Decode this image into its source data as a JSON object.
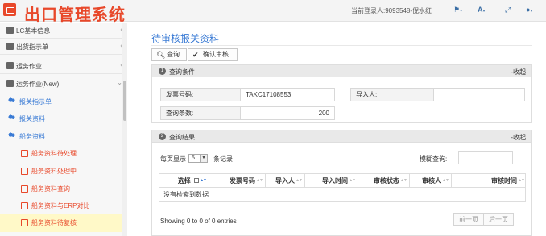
{
  "header": {
    "app_title": "出口管理系统",
    "user_info": "当前登录人:9093548-倪水红",
    "icons": [
      "flag-icon",
      "font-size-icon",
      "expand-icon",
      "user-icon"
    ]
  },
  "sidebar": {
    "items": [
      {
        "label": "LC基本信息",
        "icon": "document-icon"
      },
      {
        "label": "出货指示单",
        "icon": "document-icon"
      },
      {
        "label": "运务作业",
        "icon": "document-icon"
      },
      {
        "label": "运务作业(New)",
        "icon": "document-icon"
      },
      {
        "label": "报关指示单",
        "icon": "people-icon"
      },
      {
        "label": "报关资料",
        "icon": "people-icon"
      },
      {
        "label": "船务资料",
        "icon": "people-icon"
      },
      {
        "label": "船务资料待处理",
        "icon": "card-icon"
      },
      {
        "label": "船务资料处理中",
        "icon": "card-icon"
      },
      {
        "label": "船务资料查询",
        "icon": "card-icon"
      },
      {
        "label": "船务资料与ERP对比",
        "icon": "card-icon"
      },
      {
        "label": "船务资料待复核",
        "icon": "card-icon"
      }
    ]
  },
  "main": {
    "page_title": "待审核报关资料",
    "toolbar": {
      "query_label": "查询",
      "confirm_label": "确认审核"
    },
    "query_panel": {
      "number": "1",
      "title": "查询条件",
      "collapse_label": "-收起",
      "invoice_label": "发票号码:",
      "invoice_value": "TAKC17108553",
      "importer_label": "导入人:",
      "importer_value": "",
      "count_label": "查询条数:",
      "count_value": "200"
    },
    "result_panel": {
      "number": "2",
      "title": "查询结果",
      "collapse_label": "-收起",
      "page_size_prefix": "每页显示",
      "page_size_value": "5",
      "page_size_suffix": "条记录",
      "search_label": "模糊查询:",
      "search_value": "",
      "columns": [
        "选择",
        "发票号码",
        "导入人",
        "导入时间",
        "审核状态",
        "审核人",
        "审核时间"
      ],
      "empty_text": "没有检索到数据",
      "info_text": "Showing 0 to 0 of 0 entries",
      "prev_label": "前一页",
      "next_label": "后一页"
    }
  },
  "colors": {
    "brand": "#e8482a",
    "accent": "#3a7bd5",
    "active_row": "#fff9c8"
  }
}
